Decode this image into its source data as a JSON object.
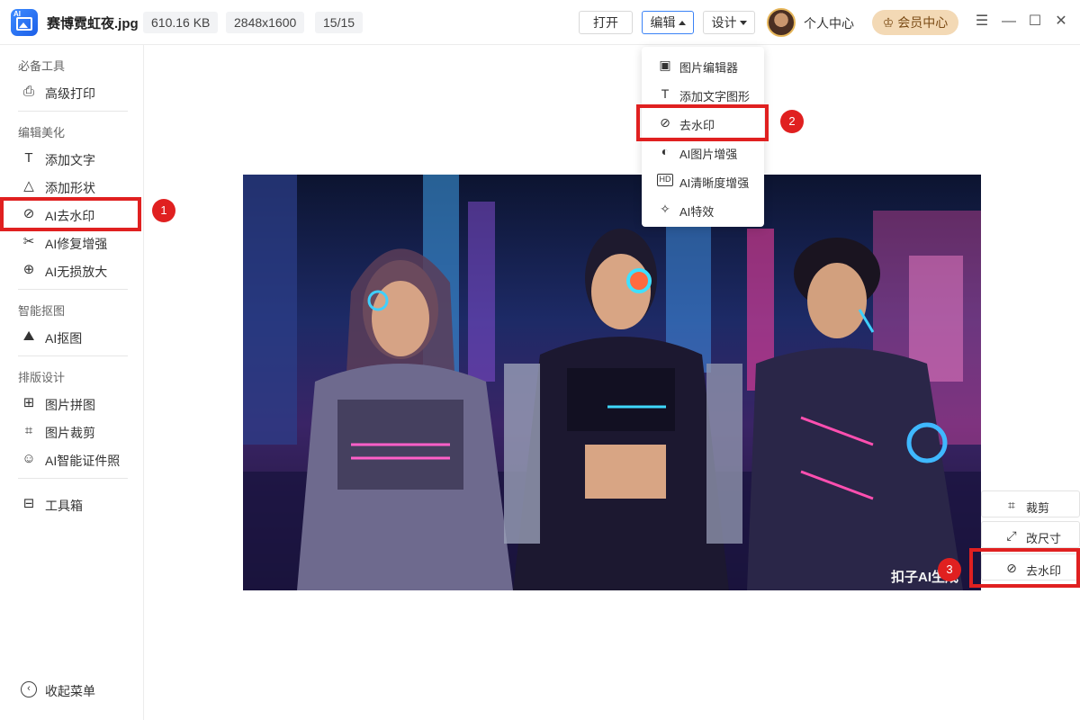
{
  "topbar": {
    "filename": "赛博霓虹夜.jpg",
    "file_size": "610.16 KB",
    "dimensions": "2848x1600",
    "page_count": "15/15",
    "open_label": "打开",
    "edit_label": "编辑",
    "design_label": "设计",
    "user_center": "个人中心",
    "vip_label": "会员中心"
  },
  "sidebar": {
    "sections": [
      {
        "title": "必备工具",
        "items": [
          {
            "label": "高级打印",
            "icon": "printer-icon"
          }
        ]
      },
      {
        "title": "编辑美化",
        "items": [
          {
            "label": "添加文字",
            "icon": "text-icon"
          },
          {
            "label": "添加形状",
            "icon": "shapes-icon"
          },
          {
            "label": "AI去水印",
            "icon": "watermark-remove-icon"
          },
          {
            "label": "AI修复增强",
            "icon": "repair-icon"
          },
          {
            "label": "AI无损放大",
            "icon": "zoom-in-icon"
          }
        ]
      },
      {
        "title": "智能抠图",
        "items": [
          {
            "label": "AI抠图",
            "icon": "cutout-icon"
          }
        ]
      },
      {
        "title": "排版设计",
        "items": [
          {
            "label": "图片拼图",
            "icon": "collage-icon"
          },
          {
            "label": "图片裁剪",
            "icon": "crop-icon"
          },
          {
            "label": "AI智能证件照",
            "icon": "id-photo-icon"
          }
        ]
      },
      {
        "title": "",
        "items": [
          {
            "label": "工具箱",
            "icon": "toolbox-icon"
          }
        ]
      }
    ],
    "collapse_label": "收起菜单"
  },
  "edit_menu": {
    "items": [
      {
        "label": "图片编辑器",
        "icon": "image-editor-icon"
      },
      {
        "label": "添加文字图形",
        "icon": "text-icon"
      },
      {
        "label": "去水印",
        "icon": "watermark-remove-icon"
      },
      {
        "label": "AI图片增强",
        "icon": "enhance-icon"
      },
      {
        "label": "AI清晰度增强",
        "icon": "hd-icon"
      },
      {
        "label": "AI特效",
        "icon": "magic-wand-icon"
      }
    ]
  },
  "float_tools": {
    "crop": "裁剪",
    "resize": "改尺寸",
    "remove_watermark": "去水印"
  },
  "image": {
    "watermark_text": "扣子AI生成"
  },
  "annotations": {
    "badge1": "1",
    "badge2": "2",
    "badge3": "3",
    "highlight_color": "#e02020"
  }
}
